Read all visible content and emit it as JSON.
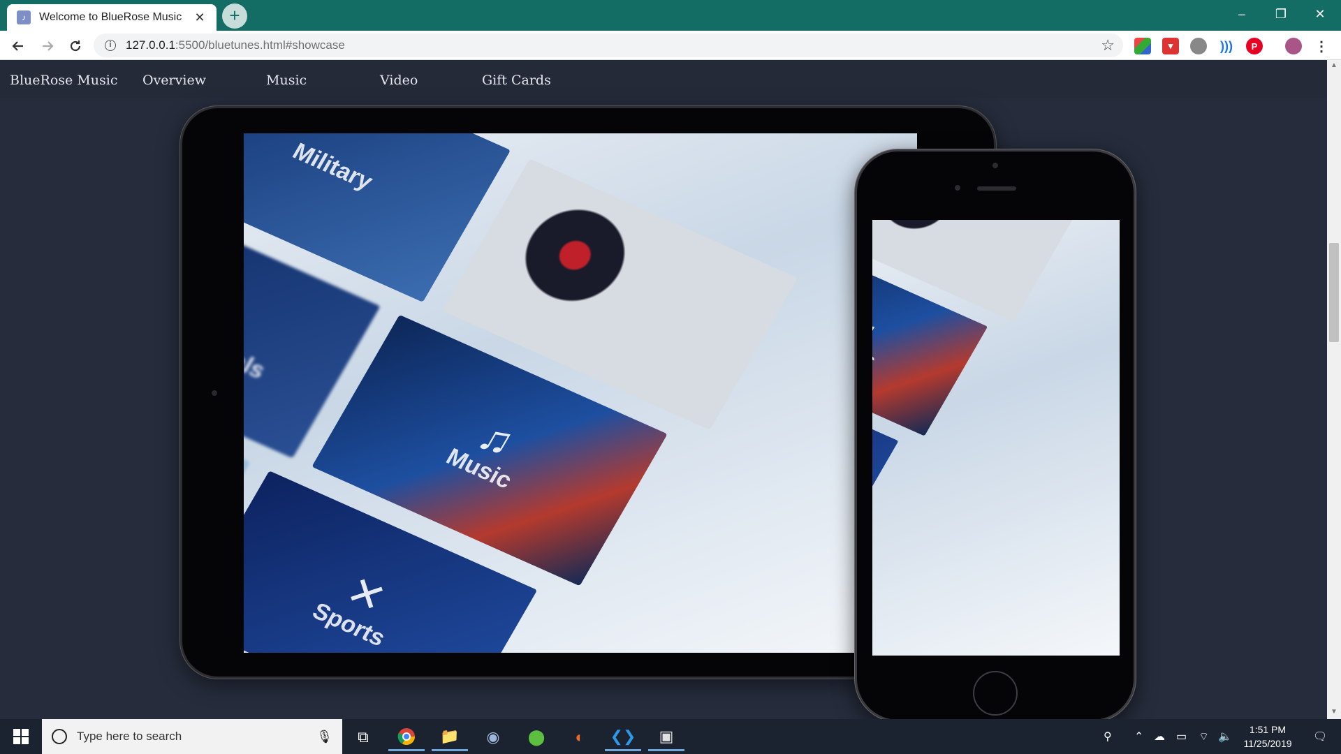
{
  "browser": {
    "tab_title": "Welcome to BlueRose Music",
    "tab_close": "✕",
    "new_tab": "+",
    "url_host": "127.0.0.1",
    "url_rest": ":5500/bluetunes.html#showcase",
    "window_controls": {
      "minimize": "–",
      "restore": "❐",
      "close": "✕"
    }
  },
  "site_nav": {
    "brand": "BlueRose Music",
    "links": [
      "Overview",
      "Music",
      "Video",
      "Gift Cards"
    ]
  },
  "showcase": {
    "tiles": {
      "military": "Military",
      "instructionals": "Instructionals",
      "music": "Music",
      "sports": "Sports"
    }
  },
  "taskbar": {
    "search_placeholder": "Type here to search",
    "time": "1:51 PM",
    "date": "11/25/2019"
  },
  "colors": {
    "titlebar": "#136d65",
    "page_bg": "#262c3c",
    "taskbar": "#1c2330"
  }
}
